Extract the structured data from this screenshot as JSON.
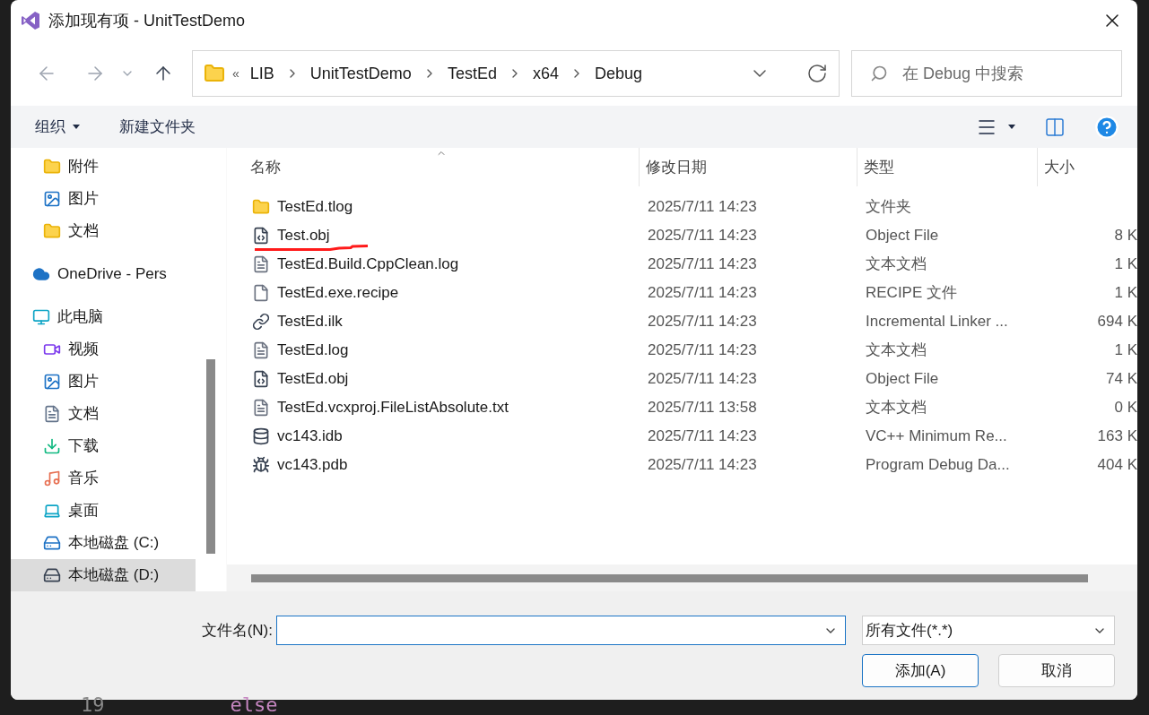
{
  "window": {
    "title": "添加现有项 - UnitTestDemo"
  },
  "address_bar": {
    "overflow": "«",
    "crumbs": [
      "LIB",
      "UnitTestDemo",
      "TestEd",
      "x64",
      "Debug"
    ]
  },
  "search": {
    "placeholder": "在 Debug 中搜索"
  },
  "toolbar": {
    "organize": "组织",
    "new_folder": "新建文件夹"
  },
  "sidebar": {
    "sections": [
      {
        "kind": "continuation",
        "items": [
          {
            "label": "附件",
            "kind": "folder",
            "selected": false
          },
          {
            "label": "图片",
            "kind": "pictures",
            "selected": false
          },
          {
            "label": "文档",
            "kind": "folder",
            "selected": false
          }
        ]
      },
      {
        "kind": "root",
        "items": [
          {
            "label": "OneDrive - Pers",
            "kind": "cloud",
            "selected": false
          }
        ]
      },
      {
        "kind": "root",
        "items": [
          {
            "label": "此电脑",
            "kind": "pc",
            "selected": false,
            "children": [
              {
                "label": "视频",
                "kind": "video",
                "selected": false
              },
              {
                "label": "图片",
                "kind": "pictures",
                "selected": false
              },
              {
                "label": "文档",
                "kind": "document",
                "selected": false
              },
              {
                "label": "下载",
                "kind": "download",
                "selected": false
              },
              {
                "label": "音乐",
                "kind": "music",
                "selected": false
              },
              {
                "label": "桌面",
                "kind": "desktop",
                "selected": false
              },
              {
                "label": "本地磁盘 (C:)",
                "kind": "system",
                "selected": false
              },
              {
                "label": "本地磁盘 (D:)",
                "kind": "drive",
                "selected": true
              }
            ]
          }
        ]
      }
    ]
  },
  "table": {
    "columns": [
      "名称",
      "修改日期",
      "类型",
      "大小"
    ],
    "rows": [
      {
        "name": "TestEd.tlog",
        "kind": "folder",
        "modified": "2025/7/11 14:23",
        "type": "文件夹",
        "marked": false
      },
      {
        "name": "Test.obj",
        "kind": "object",
        "modified": "2025/7/11 14:23",
        "type": "Object File",
        "size": "8 K",
        "marked": true
      },
      {
        "name": "TestEd.Build.CppClean.log",
        "kind": "text",
        "modified": "2025/7/11 14:23",
        "type": "文本文档",
        "size": "1 K",
        "marked": false
      },
      {
        "name": "TestEd.exe.recipe",
        "kind": "blank",
        "modified": "2025/7/11 14:23",
        "type": "RECIPE 文件",
        "size": "1 K",
        "marked": false
      },
      {
        "name": "TestEd.ilk",
        "kind": "link",
        "modified": "2025/7/11 14:23",
        "type": "Incremental Linker ...",
        "size": "694 K",
        "marked": false
      },
      {
        "name": "TestEd.log",
        "kind": "text",
        "modified": "2025/7/11 14:23",
        "type": "文本文档",
        "size": "1 K",
        "marked": false
      },
      {
        "name": "TestEd.obj",
        "kind": "object",
        "modified": "2025/7/11 14:23",
        "type": "Object File",
        "size": "74 K",
        "marked": false
      },
      {
        "name": "TestEd.vcxproj.FileListAbsolute.txt",
        "kind": "text",
        "modified": "2025/7/11 13:58",
        "type": "文本文档",
        "size": "0 K",
        "marked": false
      },
      {
        "name": "vc143.idb",
        "kind": "database",
        "modified": "2025/7/11 14:23",
        "type": "VC++ Minimum Re...",
        "size": "163 K",
        "marked": false
      },
      {
        "name": "vc143.pdb",
        "kind": "debug",
        "modified": "2025/7/11 14:23",
        "type": "Program Debug Da...",
        "size": "404 K",
        "marked": false
      }
    ]
  },
  "footer": {
    "filename_label": "文件名(N):",
    "filter": "所有文件(*.*)",
    "buttons": [
      {
        "label": "添加(A)",
        "default": true
      },
      {
        "label": "取消",
        "default": false
      }
    ]
  },
  "background_editor": {
    "line_number": "19",
    "code": "else"
  }
}
